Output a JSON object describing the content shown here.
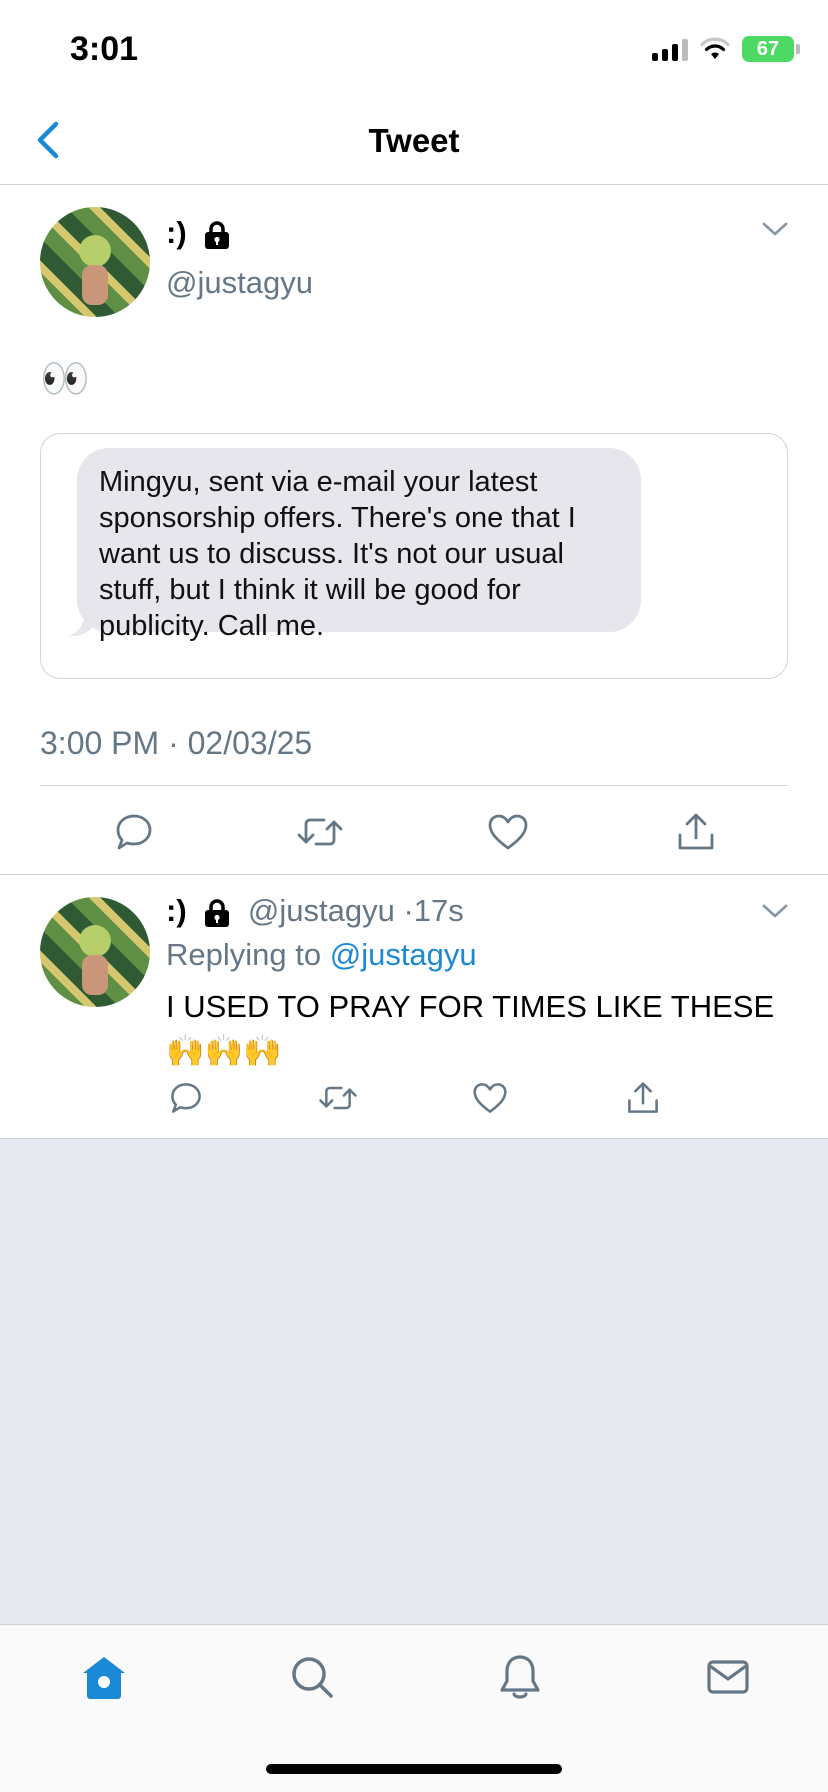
{
  "status_bar": {
    "time": "3:01",
    "battery": "67"
  },
  "nav": {
    "title": "Tweet"
  },
  "tweet": {
    "display_name": ":)",
    "handle": "@justagyu",
    "text": "👀",
    "quoted_message": "Mingyu, sent via e-mail your latest sponsorship offers. There's one that I want us to discuss. It's not our usual stuff, but I think it will be good for publicity. Call me.",
    "timestamp": "3:00 PM · 02/03/25"
  },
  "reply": {
    "display_name": ":)",
    "handle": "@justagyu",
    "separator": "·",
    "age": "17s",
    "replying_to_label": "Replying to",
    "replying_to_handle": "@justagyu",
    "text": "I USED TO PRAY FOR TIMES LIKE THESE 🙌🙌🙌"
  },
  "icons": {
    "back": "chevron-left-icon",
    "lock": "lock-icon",
    "menu": "chevron-down-icon",
    "reply": "comment-icon",
    "retweet": "retweet-icon",
    "like": "heart-icon",
    "share": "share-icon",
    "home": "home-icon",
    "search": "search-icon",
    "notifications": "bell-icon",
    "messages": "mail-icon"
  },
  "colors": {
    "accent": "#1b8ad6",
    "secondary_text": "#657786",
    "empty_background": "#e6e9f0",
    "bubble": "#e6e6ec",
    "battery": "#4cd964"
  }
}
